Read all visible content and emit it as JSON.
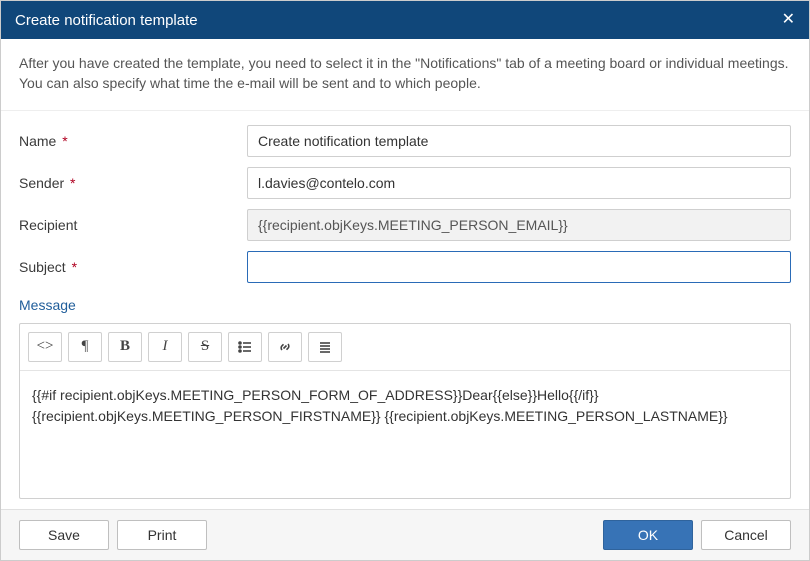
{
  "dialog": {
    "title": "Create notification template",
    "intro": "After you have created the template, you need to select it in the \"Notifications\" tab of a meeting board or individual meetings. You can also specify what time the e-mail will be sent and to which people."
  },
  "fields": {
    "name": {
      "label": "Name",
      "required": true,
      "value": "Create notification template"
    },
    "sender": {
      "label": "Sender",
      "required": true,
      "value": "l.davies@contelo.com"
    },
    "recipient": {
      "label": "Recipient",
      "required": false,
      "value": "{{recipient.objKeys.MEETING_PERSON_EMAIL}}"
    },
    "subject": {
      "label": "Subject",
      "required": true,
      "value": ""
    }
  },
  "message": {
    "label": "Message",
    "body": "{{#if recipient.objKeys.MEETING_PERSON_FORM_OF_ADDRESS}}Dear{{else}}Hello{{/if}} {{recipient.objKeys.MEETING_PERSON_FIRSTNAME}} {{recipient.objKeys.MEETING_PERSON_LASTNAME}}"
  },
  "toolbar": {
    "code": "<>",
    "pilcrow": "¶",
    "bold": "B",
    "italic": "I",
    "strike": "S"
  },
  "footer": {
    "save": "Save",
    "print": "Print",
    "ok": "OK",
    "cancel": "Cancel"
  }
}
